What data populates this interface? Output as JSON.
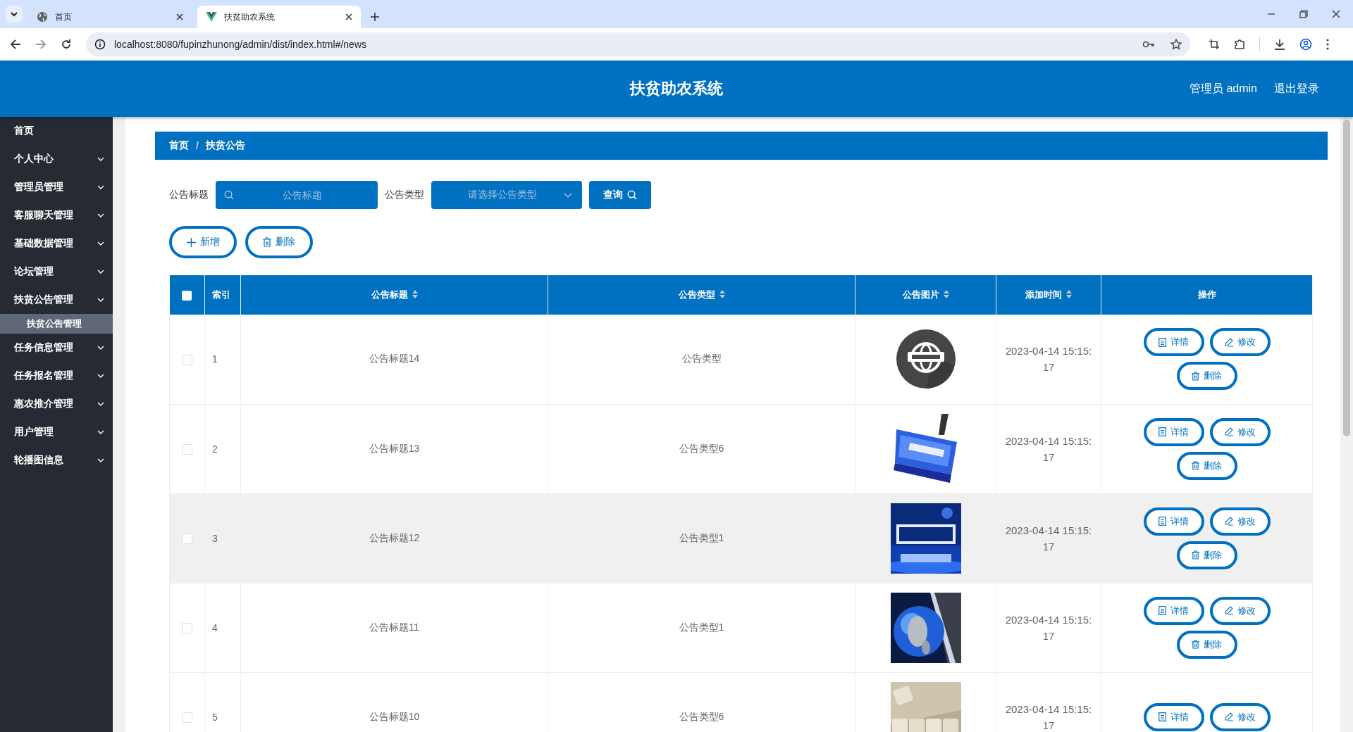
{
  "browser": {
    "tabs": [
      {
        "title": "首页",
        "selected": false,
        "kind": "globe"
      },
      {
        "title": "扶贫助农系统",
        "selected": true,
        "kind": "app"
      }
    ],
    "url": "localhost:8080/fupinzhunong/admin/dist/index.html#/news"
  },
  "header": {
    "title": "扶贫助农系统",
    "user": "管理员 admin",
    "logout": "退出登录"
  },
  "sidebar": [
    {
      "label": "首页",
      "kind": "link"
    },
    {
      "label": "个人中心",
      "kind": "menu"
    },
    {
      "label": "管理员管理",
      "kind": "menu"
    },
    {
      "label": "客服聊天管理",
      "kind": "menu"
    },
    {
      "label": "基础数据管理",
      "kind": "menu"
    },
    {
      "label": "论坛管理",
      "kind": "menu"
    },
    {
      "label": "扶贫公告管理",
      "kind": "menu",
      "children": [
        {
          "label": "扶贫公告管理",
          "selected": true
        }
      ]
    },
    {
      "label": "任务信息管理",
      "kind": "menu"
    },
    {
      "label": "任务报名管理",
      "kind": "menu"
    },
    {
      "label": "惠农推介管理",
      "kind": "menu"
    },
    {
      "label": "用户管理",
      "kind": "menu"
    },
    {
      "label": "轮播图信息",
      "kind": "menu"
    }
  ],
  "breadcrumb": {
    "items": [
      "首页",
      "扶贫公告"
    ],
    "separator": "/"
  },
  "filters": [
    {
      "label": "公告标题",
      "kind": "search",
      "placeholder": "公告标题"
    },
    {
      "label": "公告类型",
      "kind": "select",
      "placeholder": "请选择公告类型"
    }
  ],
  "query_button": "查询",
  "actions": [
    {
      "label": "新增",
      "kind": "add"
    },
    {
      "label": "删除",
      "kind": "delete"
    }
  ],
  "table": {
    "select_all": {
      "checked": false
    },
    "columns": [
      {
        "label": "索引",
        "sortable": false
      },
      {
        "label": "公告标题",
        "sortable": true
      },
      {
        "label": "公告类型",
        "sortable": true
      },
      {
        "label": "公告图片",
        "sortable": true
      },
      {
        "label": "添加时间",
        "sortable": true
      },
      {
        "label": "操作",
        "sortable": false
      }
    ],
    "rows": [
      {
        "checked": false,
        "hovered": false,
        "index": "1",
        "title": "公告标题14",
        "type": "公告类型",
        "image": {
          "kind": "picture"
        },
        "time": "2023-04-14 15:15:17",
        "actions": [
          {
            "label": "详情",
            "kind": "detail"
          },
          {
            "label": "修改",
            "kind": "edit"
          },
          {
            "label": "删除",
            "kind": "delete"
          }
        ]
      },
      {
        "checked": false,
        "hovered": false,
        "index": "2",
        "title": "公告标题13",
        "type": "公告类型6",
        "image": {
          "kind": "picture"
        },
        "time": "2023-04-14 15:15:17",
        "actions": [
          {
            "label": "详情",
            "kind": "detail"
          },
          {
            "label": "修改",
            "kind": "edit"
          },
          {
            "label": "删除",
            "kind": "delete"
          }
        ]
      },
      {
        "checked": false,
        "hovered": true,
        "index": "3",
        "title": "公告标题12",
        "type": "公告类型1",
        "image": {
          "kind": "picture"
        },
        "time": "2023-04-14 15:15:17",
        "actions": [
          {
            "label": "详情",
            "kind": "detail"
          },
          {
            "label": "修改",
            "kind": "edit"
          },
          {
            "label": "删除",
            "kind": "delete"
          }
        ]
      },
      {
        "checked": false,
        "hovered": false,
        "index": "4",
        "title": "公告标题11",
        "type": "公告类型1",
        "image": {
          "kind": "picture"
        },
        "time": "2023-04-14 15:15:17",
        "actions": [
          {
            "label": "详情",
            "kind": "detail"
          },
          {
            "label": "修改",
            "kind": "edit"
          },
          {
            "label": "删除",
            "kind": "delete"
          }
        ]
      },
      {
        "checked": false,
        "hovered": false,
        "index": "5",
        "title": "公告标题10",
        "type": "公告类型6",
        "image": {
          "kind": "picture"
        },
        "time": "2023-04-14 15:15:17",
        "actions": [
          {
            "label": "详情",
            "kind": "detail"
          },
          {
            "label": "修改",
            "kind": "edit"
          }
        ]
      }
    ]
  }
}
